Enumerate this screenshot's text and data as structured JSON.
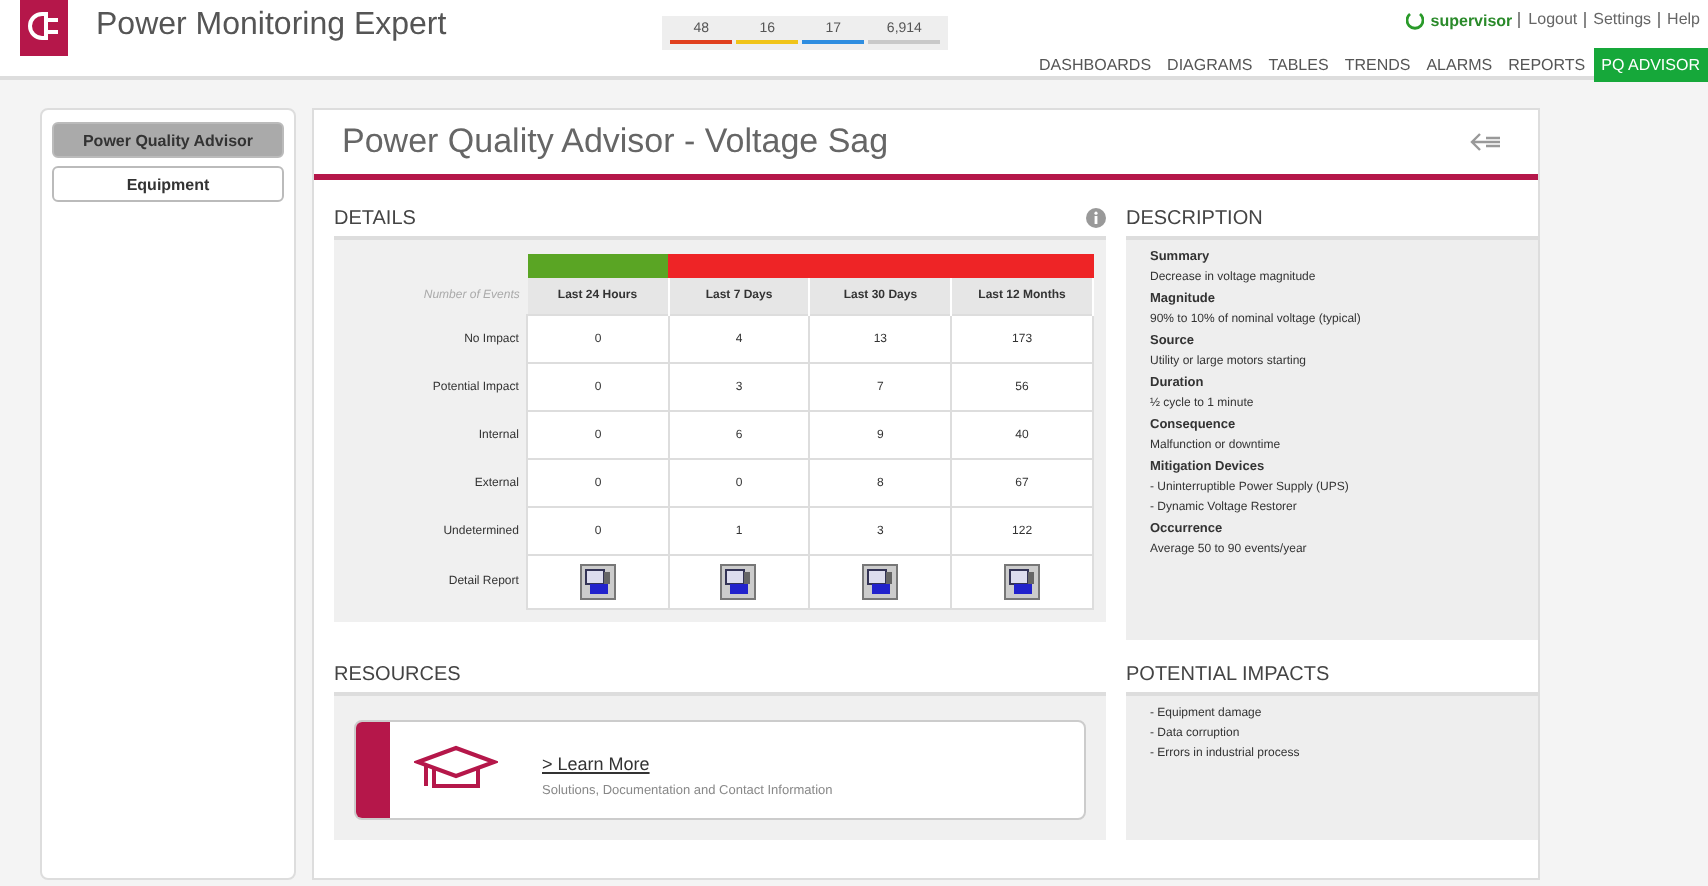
{
  "header": {
    "app_title": "Power Monitoring Expert",
    "counters": [
      {
        "value": "48",
        "color": "#e0401e"
      },
      {
        "value": "16",
        "color": "#f0c419"
      },
      {
        "value": "17",
        "color": "#2e8de0"
      },
      {
        "value": "6,914",
        "color": "#c8c8c8"
      }
    ],
    "user": "supervisor",
    "links": [
      "Logout",
      "Settings",
      "Help"
    ],
    "nav": [
      {
        "label": "DASHBOARDS",
        "selected": false
      },
      {
        "label": "DIAGRAMS",
        "selected": false
      },
      {
        "label": "TABLES",
        "selected": false
      },
      {
        "label": "TRENDS",
        "selected": false
      },
      {
        "label": "ALARMS",
        "selected": false
      },
      {
        "label": "REPORTS",
        "selected": false
      },
      {
        "label": "PQ ADVISOR",
        "selected": true
      }
    ]
  },
  "sidebar": {
    "items": [
      {
        "label": "Power Quality Advisor",
        "selected": true
      },
      {
        "label": "Equipment",
        "selected": false
      }
    ]
  },
  "page_title": "Power Quality Advisor - Voltage Sag",
  "details": {
    "title": "DETAILS",
    "corner_label": "Number of Events",
    "columns": [
      {
        "label": "Last 24 Hours",
        "color": "#5aa524"
      },
      {
        "label": "Last 7 Days",
        "color": "#ee2426"
      },
      {
        "label": "Last 30 Days",
        "color": "#ee2426"
      },
      {
        "label": "Last 12 Months",
        "color": "#ee2426"
      }
    ],
    "rows": [
      {
        "label": "No Impact",
        "values": [
          "0",
          "4",
          "13",
          "173"
        ]
      },
      {
        "label": "Potential Impact",
        "values": [
          "0",
          "3",
          "7",
          "56"
        ]
      },
      {
        "label": "Internal",
        "values": [
          "0",
          "6",
          "9",
          "40"
        ]
      },
      {
        "label": "External",
        "values": [
          "0",
          "0",
          "8",
          "67"
        ]
      },
      {
        "label": "Undetermined",
        "values": [
          "0",
          "1",
          "3",
          "122"
        ]
      }
    ],
    "report_row_label": "Detail Report"
  },
  "description": {
    "title": "DESCRIPTION",
    "items": [
      {
        "kind": "heading",
        "text": "Summary"
      },
      {
        "kind": "text",
        "text": "Decrease in voltage magnitude"
      },
      {
        "kind": "heading",
        "text": "Magnitude"
      },
      {
        "kind": "text",
        "text": "90% to 10% of nominal voltage (typical)"
      },
      {
        "kind": "heading",
        "text": "Source"
      },
      {
        "kind": "text",
        "text": "Utility or large motors starting"
      },
      {
        "kind": "heading",
        "text": "Duration"
      },
      {
        "kind": "text",
        "text": "½ cycle to 1 minute"
      },
      {
        "kind": "heading",
        "text": "Consequence"
      },
      {
        "kind": "text",
        "text": "Malfunction or downtime"
      },
      {
        "kind": "heading",
        "text": "Mitigation Devices"
      },
      {
        "kind": "text",
        "text": "- Uninterruptible Power Supply (UPS)"
      },
      {
        "kind": "text",
        "text": "- Dynamic Voltage Restorer"
      },
      {
        "kind": "heading",
        "text": "Occurrence"
      },
      {
        "kind": "text",
        "text": "Average 50 to 90 events/year"
      }
    ]
  },
  "resources": {
    "title": "RESOURCES",
    "link": "> Learn More",
    "subtitle": "Solutions, Documentation and Contact Information"
  },
  "potential_impacts": {
    "title": "POTENTIAL IMPACTS",
    "items": [
      "- Equipment damage",
      "- Data corruption",
      "- Errors in industrial process"
    ]
  }
}
